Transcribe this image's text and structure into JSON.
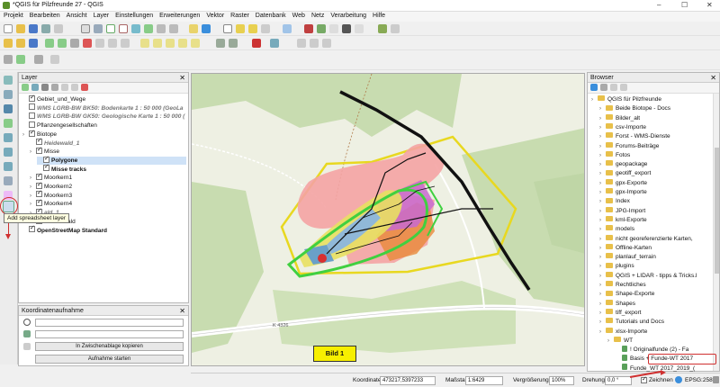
{
  "window": {
    "title": "*QGIS für Pilzfreunde 27 - QGIS",
    "minimize": "–",
    "maximize": "☐",
    "close": "✕"
  },
  "menu": [
    "Projekt",
    "Bearbeiten",
    "Ansicht",
    "Layer",
    "Einstellungen",
    "Erweiterungen",
    "Vektor",
    "Raster",
    "Datenbank",
    "Web",
    "Netz",
    "Verarbeitung",
    "Hilfe"
  ],
  "layers_panel": {
    "title": "Layer",
    "items": [
      {
        "label": "Gebiet_und_Wege",
        "checked": true,
        "style": "normal"
      },
      {
        "label": "WMS LGRB-BW BK50: Bodenkarte 1 : 50 000 (GeoLa",
        "checked": false,
        "style": "italic-bold"
      },
      {
        "label": "WMS LGRB-BW GK50: Geologische Karte 1 : 50 000 (",
        "checked": false,
        "style": "italic-bold"
      },
      {
        "label": "Pflanzengesellschaften",
        "checked": false,
        "style": "normal"
      },
      {
        "label": "Biotope",
        "checked": true,
        "style": "normal"
      },
      {
        "label": "Heidewald_1",
        "checked": true,
        "style": "italic-bold"
      },
      {
        "label": "Misse",
        "checked": true,
        "style": "normal"
      },
      {
        "label": "Polygone",
        "checked": true,
        "style": "bold-selected"
      },
      {
        "label": "Misse tracks",
        "checked": true,
        "style": "bold"
      },
      {
        "label": "Moorkern1",
        "checked": true,
        "style": "normal"
      },
      {
        "label": "Moorkern2",
        "checked": true,
        "style": "normal"
      },
      {
        "label": "Moorkern3",
        "checked": true,
        "style": "normal"
      },
      {
        "label": "Moorkern4",
        "checked": true,
        "style": "normal"
      },
      {
        "label": "ald_1",
        "checked": true,
        "style": "italic-bold"
      },
      {
        "label": "Tannenwald",
        "checked": true,
        "style": "normal"
      },
      {
        "label": "OpenStreetMap Standard",
        "checked": true,
        "style": "bold"
      }
    ]
  },
  "tooltip": "Add spreadsheet layer",
  "coord_panel": {
    "title": "Koordinatenaufnahme",
    "copy_button": "In Zwischenablage kopieren",
    "start_button": "Aufnahme starten"
  },
  "browser_panel": {
    "title": "Browser",
    "items": [
      {
        "label": "QGIS für Pilzfreunde",
        "depth": 0
      },
      {
        "label": "Beide Biotope - Docs",
        "depth": 1
      },
      {
        "label": "Bilder_alt",
        "depth": 1
      },
      {
        "label": "csv-Importe",
        "depth": 1
      },
      {
        "label": "Forst - WMS-Dienste",
        "depth": 1
      },
      {
        "label": "Forums-Beiträge",
        "depth": 1
      },
      {
        "label": "Fotos",
        "depth": 1
      },
      {
        "label": "geopackage",
        "depth": 1
      },
      {
        "label": "geotiff_export",
        "depth": 1
      },
      {
        "label": "gpx-Exporte",
        "depth": 1
      },
      {
        "label": "gpx-Importe",
        "depth": 1
      },
      {
        "label": "Index",
        "depth": 1
      },
      {
        "label": "JPG-Import",
        "depth": 1
      },
      {
        "label": "kml-Exporte",
        "depth": 1
      },
      {
        "label": "models",
        "depth": 1
      },
      {
        "label": "nicht georeferenzierte Karten,",
        "depth": 1
      },
      {
        "label": "Offline-Karten",
        "depth": 1
      },
      {
        "label": "planlauf_terrain",
        "depth": 1
      },
      {
        "label": "plugins",
        "depth": 1
      },
      {
        "label": "QGIS + LIDAR - tipps & Tricks.l",
        "depth": 1
      },
      {
        "label": "Rechtliches",
        "depth": 1
      },
      {
        "label": "Shape-Exporte",
        "depth": 1
      },
      {
        "label": "Shapes",
        "depth": 1
      },
      {
        "label": "tiff_export",
        "depth": 1
      },
      {
        "label": "Tutorials und Docs",
        "depth": 1
      },
      {
        "label": "xlsx-Importe",
        "depth": 1
      },
      {
        "label": "WT",
        "depth": 2
      },
      {
        "label": "! Originalfunde (2) - Fa",
        "depth": 3
      },
      {
        "label": "Basis + Funde-WT 2017",
        "depth": 3
      },
      {
        "label": "Funde_WT 2017_2019_(",
        "depth": 3
      }
    ]
  },
  "map": {
    "road_label": "K 4326",
    "bild_label": "Bild 1"
  },
  "status": {
    "coord_label": "Koordinate",
    "coord_value": "473217,5397233",
    "scale_label": "Maßstab",
    "scale_value": "1:6429",
    "magnifier_label": "Vergrößerung",
    "magnifier_value": "100%",
    "rotation_label": "Drehung",
    "rotation_value": "0,0 °",
    "render_label": "Zeichnen",
    "crs": "EPSG:25832"
  },
  "colors": {
    "accent": "#d03030",
    "map_bg": "#eef0e3",
    "forest": "#c8dcb0",
    "highlight": "#ffff5c"
  }
}
